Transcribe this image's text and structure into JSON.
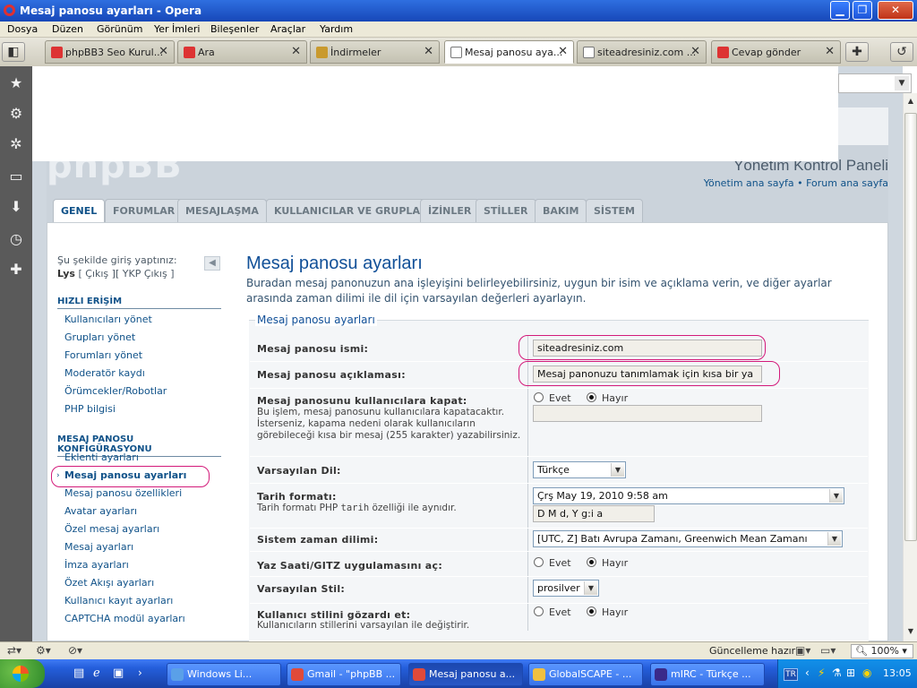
{
  "window": {
    "title": "Mesaj panosu ayarları - Opera"
  },
  "menu": [
    "Dosya",
    "Düzen",
    "Görünüm",
    "Yer İmleri",
    "Bileşenler",
    "Araçlar",
    "Yardım"
  ],
  "tabs": [
    {
      "label": "phpBB3 Seo Kurul..."
    },
    {
      "label": "Ara"
    },
    {
      "label": "İndirmeler"
    },
    {
      "label": "Mesaj panosu aya..."
    },
    {
      "label": "siteadresiniz.com ..."
    },
    {
      "label": "Cevap gönder"
    }
  ],
  "header": {
    "logo": "phpBB",
    "acp_title": "Yönetim Kontrol Paneli",
    "home_link": "Yönetim ana sayfa",
    "bullet": "•",
    "forum_link": "Forum ana sayfa"
  },
  "maintabs": [
    "GENEL",
    "FORUMLAR",
    "MESAJLAŞMA",
    "KULLANICILAR VE GRUPLAR",
    "İZİNLER",
    "STİLLER",
    "BAKIM",
    "SİSTEM"
  ],
  "login": {
    "line1": "Şu şekilde giriş yaptınız:",
    "user": "Lys",
    "logout": "[ Çıkış ]",
    "ykp_logout": "[ YKP Çıkış ]"
  },
  "sidebar": {
    "quick_heading": "HIZLI ERİŞİM",
    "quick": [
      "Kullanıcıları yönet",
      "Grupları yönet",
      "Forumları yönet",
      "Moderatör kaydı",
      "Örümcekler/Robotlar",
      "PHP bilgisi"
    ],
    "config_heading": "MESAJ PANOSU KONFİGÜRASYONU",
    "config": [
      "Eklenti ayarları",
      "Mesaj panosu ayarları",
      "Mesaj panosu özellikleri",
      "Avatar ayarları",
      "Özel mesaj ayarları",
      "Mesaj ayarları",
      "İmza ayarları",
      "Özet Akışı ayarları",
      "Kullanıcı kayıt ayarları",
      "CAPTCHA modül ayarları"
    ]
  },
  "main": {
    "title": "Mesaj panosu ayarları",
    "desc": "Buradan mesaj panonuzun ana işleyişini belirleyebilirsiniz, uygun bir isim ve açıklama verin, ve diğer ayarlar arasında zaman dilimi ile dil için varsayılan değerleri ayarlayın.",
    "legend": "Mesaj panosu ayarları",
    "fields": {
      "name_label": "Mesaj panosu ismi:",
      "name_value": "siteadresiniz.com",
      "desc_label": "Mesaj panosu açıklaması:",
      "desc_value": "Mesaj panonuzu tanımlamak için kısa bir ya",
      "disable_label": "Mesaj panosunu kullanıcılara kapat:",
      "disable_help": "Bu işlem, mesaj panosunu kullanıcılara kapatacaktır. İsterseniz, kapama nedeni olarak kullanıcıların görebileceği kısa bir mesaj (255 karakter) yazabilirsiniz.",
      "yes": "Evet",
      "no": "Hayır",
      "lang_label": "Varsayılan Dil:",
      "lang_value": "Türkçe",
      "date_label": "Tarih formatı:",
      "date_help_pre": "Tarih formatı PHP",
      "date_help_code": "tarih",
      "date_help_post": "özelliği ile aynıdır.",
      "date_value": "Çrş May 19, 2010 9:58 am",
      "date_custom": "D M d, Y g:i a",
      "tz_label": "Sistem zaman dilimi:",
      "tz_value": "[UTC, Z] Batı Avrupa Zamanı, Greenwich Mean Zamanı",
      "dst_label": "Yaz Saati/GITZ uygulamasını aç:",
      "style_label": "Varsayılan Stil:",
      "style_value": "prosilver",
      "override_label": "Kullanıcı stilini gözardı et:",
      "override_help": "Kullanıcıların stillerini varsayılan ile değiştirir."
    }
  },
  "status": {
    "ready": "Güncelleme hazır",
    "zoom": "100%"
  },
  "taskbar": {
    "items": [
      "Windows Li...",
      "Gmail - \"phpBB ...",
      "Mesaj panosu a...",
      "GlobalSCAPE - ...",
      "mIRC - Türkçe ..."
    ],
    "tray_lang": "TR",
    "clock": "13:05"
  }
}
